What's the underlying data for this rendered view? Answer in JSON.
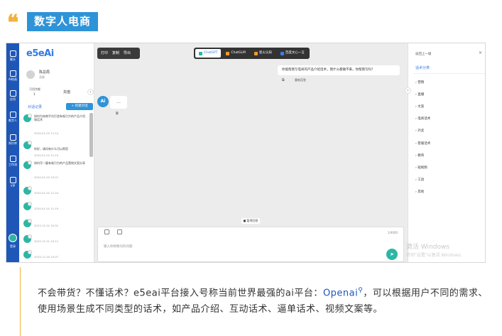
{
  "header": {
    "tag": "数字人电商",
    "quote_mark": "❝"
  },
  "app": {
    "logo": "e5eAi",
    "appbar": [
      {
        "label": "聊天",
        "icon": "chat-icon"
      },
      {
        "label": "AI绘画",
        "icon": "paint-icon"
      },
      {
        "label": "应用",
        "icon": "app-icon"
      },
      {
        "label": "数字人",
        "icon": "person-icon"
      },
      {
        "label": "知识库",
        "icon": "book-icon"
      },
      {
        "label": "工作流",
        "icon": "flow-icon"
      },
      {
        "label": "VIP",
        "icon": "vip-icon"
      }
    ],
    "appbar_bottom": "登录",
    "user": {
      "name": "陈总局",
      "state": "游客",
      "balance_label": "可用余额",
      "balance_value": "1",
      "recharge": "充值"
    },
    "history_title": "对话记录",
    "new_chat": "+ 新建对话",
    "history": [
      {
        "title": "如何为电商平台打造有吸引力的产品介绍和话术",
        "date": "2024-01-03 11:14"
      },
      {
        "title": "你好，请问有什么可以帮您",
        "date": "2024-01-02 11:10"
      },
      {
        "title": "如何写一篇有吸引力的产品营销文案分享",
        "date": "2024-01-02 10:47"
      },
      {
        "title": "",
        "date": "2024-01-01 11:24"
      },
      {
        "title": "",
        "date": "2024-01-01 11:19"
      },
      {
        "title": "",
        "date": "2023-12-31 10:52"
      },
      {
        "title": "",
        "date": "2023-12-31 10:11"
      },
      {
        "title": "",
        "date": "2023-12-30 10:07"
      }
    ],
    "toolbar": {
      "a": "打印",
      "b": "复制",
      "c": "导出"
    },
    "models": [
      {
        "label": "ChatGPT",
        "active": true
      },
      {
        "label": "ChatGLM",
        "active": false
      },
      {
        "label": "星火认知",
        "active": false
      },
      {
        "label": "百度文心一言",
        "active": false
      }
    ],
    "user_message": "你能帮我写电商的产品介绍话术，我什么都做不来，你帮我写吗？",
    "msg_copy": "⧉",
    "msg_edit": "重新回答",
    "bot_avatar": "Ai",
    "bot_reply": "...",
    "pause": "■ 暂停回答",
    "input_placeholder": "输入你想要问的问题",
    "char_count": "1/4000",
    "right_panel": {
      "head": "返回上一级",
      "title": "话术分类",
      "categories": [
        "营销",
        "直播",
        "文案",
        "电商话术",
        "外卖",
        "客服话术",
        "教育",
        "短视频",
        "工具",
        "其他"
      ]
    },
    "watermark_1": "激活 Windows",
    "watermark_2": "转到\"设置\"以激活 Windows。"
  },
  "caption": {
    "pre": "不会带货？不懂话术？e5eai平台接入号称当前世界最强的ai平台：",
    "link": "Openai",
    "post": "，可以根据用户不同的需求、使用场景生成不同类型的话术，如产品介绍、互动话术、逼单话术、视频文案等。"
  }
}
